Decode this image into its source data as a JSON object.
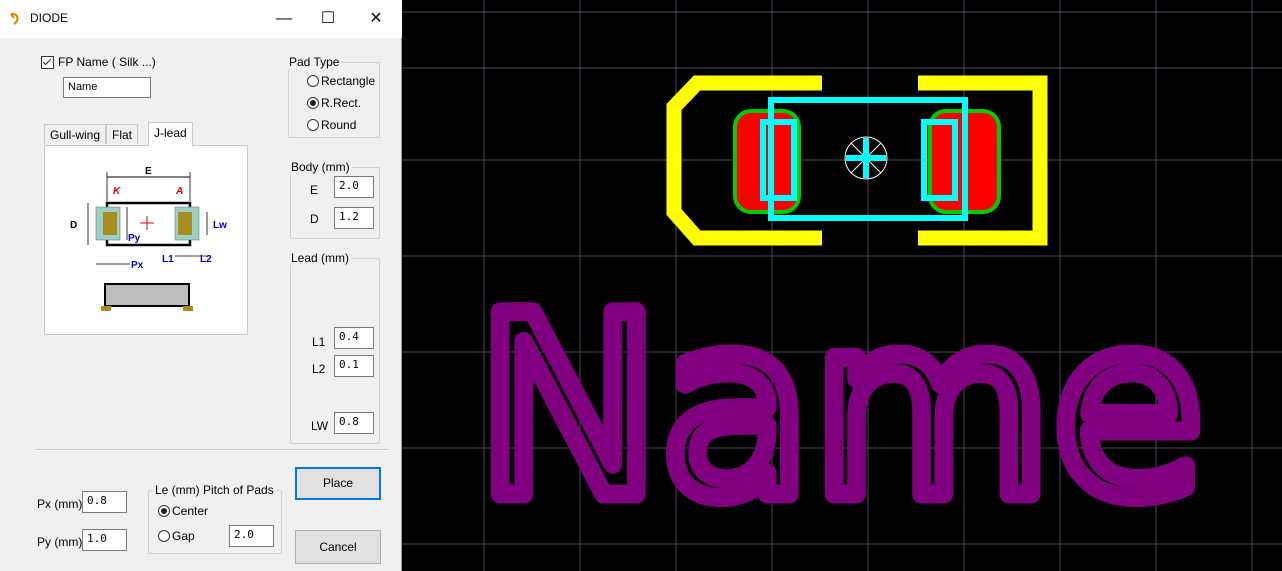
{
  "window": {
    "title": "DIODE",
    "minimize": "—",
    "maximize": "☐",
    "close": "✕"
  },
  "fp_name": {
    "label": "FP Name ( Silk ...)",
    "checked": true,
    "value": "Name"
  },
  "tabs": [
    {
      "label": "Gull-wing",
      "active": false
    },
    {
      "label": "Flat",
      "active": false
    },
    {
      "label": "J-lead",
      "active": true
    }
  ],
  "diagram": {
    "E": "E",
    "K": "K",
    "A": "A",
    "D": "D",
    "Lw": "Lw",
    "Py": "Py",
    "Px": "Px",
    "L1": "L1",
    "L2": "L2"
  },
  "pad_type": {
    "title": "Pad Type",
    "options": [
      {
        "label": "Rectangle",
        "selected": false
      },
      {
        "label": "R.Rect.",
        "selected": true
      },
      {
        "label": "Round",
        "selected": false
      }
    ]
  },
  "body": {
    "title": "Body (mm)",
    "fields": [
      {
        "label": "E",
        "value": "2.0"
      },
      {
        "label": "D",
        "value": "1.2"
      }
    ]
  },
  "lead": {
    "title": "Lead (mm)",
    "fields": [
      {
        "label": "L1",
        "value": "0.4"
      },
      {
        "label": "L2",
        "value": "0.1"
      },
      {
        "label": "LW",
        "value": "0.8"
      }
    ]
  },
  "px": {
    "label": "Px (mm)",
    "value": "0.8"
  },
  "py": {
    "label": "Py (mm)",
    "value": "1.0"
  },
  "pitch": {
    "title": "Le (mm)  Pitch of Pads",
    "options": [
      {
        "label": "Center",
        "selected": true
      },
      {
        "label": "Gap",
        "selected": false
      }
    ],
    "value": "2.0"
  },
  "buttons": {
    "place": "Place",
    "cancel": "Cancel"
  },
  "canvas": {
    "silk_text": "Name",
    "colors": {
      "silk": "#800080",
      "outline": "#ffff00",
      "pad": "#ff0000",
      "pad_edge": "#00ff00",
      "body": "#00ffff",
      "grid": "#4a4a5a"
    }
  }
}
